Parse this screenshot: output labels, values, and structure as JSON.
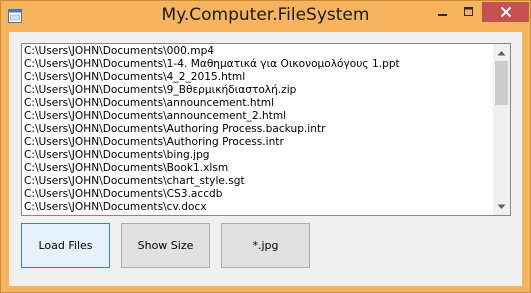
{
  "window": {
    "title": "My.Computer.FileSystem",
    "controls": {
      "minimize": "minimize",
      "maximize": "maximize",
      "close": "close"
    },
    "colors": {
      "frame": "#f7b45f",
      "close_button": "#c75050",
      "client_background": "#f0f0f0"
    }
  },
  "file_list": {
    "items": [
      "C:\\Users\\JOHN\\Documents\\000.mp4",
      "C:\\Users\\JOHN\\Documents\\1-4. Μαθηματικά για Οικονομολόγους 1.ppt",
      "C:\\Users\\JOHN\\Documents\\4_2_2015.html",
      "C:\\Users\\JOHN\\Documents\\9_Βθερμικήδιαστολή.zip",
      "C:\\Users\\JOHN\\Documents\\announcement.html",
      "C:\\Users\\JOHN\\Documents\\announcement_2.html",
      "C:\\Users\\JOHN\\Documents\\Authoring Process.backup.intr",
      "C:\\Users\\JOHN\\Documents\\Authoring Process.intr",
      "C:\\Users\\JOHN\\Documents\\bing.jpg",
      "C:\\Users\\JOHN\\Documents\\Book1.xlsm",
      "C:\\Users\\JOHN\\Documents\\chart_style.sgt",
      "C:\\Users\\JOHN\\Documents\\CS3.accdb",
      "C:\\Users\\JOHN\\Documents\\cv.docx"
    ]
  },
  "buttons": {
    "load_files": "Load Files",
    "show_size": "Show Size",
    "jpg_filter": "*.jpg"
  }
}
